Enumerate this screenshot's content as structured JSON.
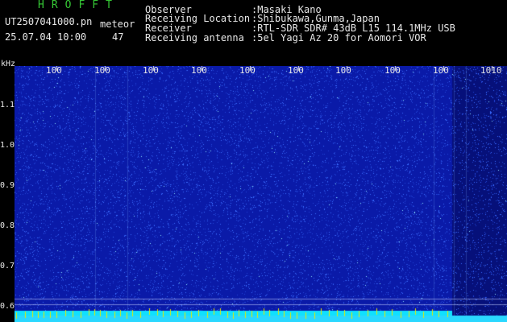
{
  "header": {
    "app_title": "HROFFT",
    "file_name": "UT2507041000.pn",
    "meteor_label": "meteor",
    "date_time": "25.07.04 10:00",
    "meteor_count": "47"
  },
  "info": {
    "observer_key": "Observer",
    "observer_val": ":Masaki Kano",
    "location_key": "Receiving Location",
    "location_val": ":Shibukawa,Gunma,Japan",
    "receiver_key": "Receiver",
    "receiver_val": ":RTL-SDR SDR# 43dB L15 114.1MHz USB",
    "antenna_key": "Receiving antenna",
    "antenna_val": ":5el Yagi Az 20 for Aomori VOR"
  },
  "axis": {
    "unit": "kHz",
    "y_ticks": [
      "1.1",
      "1.0",
      "0.9",
      "0.8",
      "0.7",
      "0.6"
    ],
    "x_ticks": [
      "100",
      "100",
      "100",
      "100",
      "100",
      "100",
      "100",
      "100",
      "100",
      "1010"
    ]
  },
  "colors": {
    "background": "#0a1aa8",
    "noise": "#3b6cff",
    "bright": "#8fe8ff",
    "baseline": "#2ad8ff",
    "marker": "#e8e800",
    "title_green": "#35c835"
  }
}
